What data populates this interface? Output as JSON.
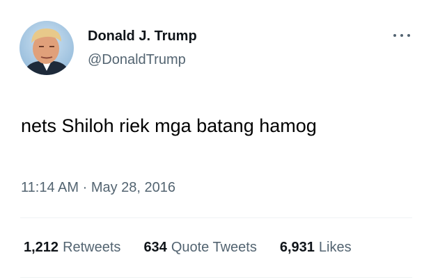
{
  "author": {
    "name": "Donald J. Trump",
    "handle": "@DonaldTrump"
  },
  "menu_icon": "more-horizontal-icon",
  "tweet": {
    "text": "nets Shiloh riek mga batang hamog",
    "time": "11:14 AM",
    "separator": "·",
    "date": "May 28, 2016"
  },
  "stats": [
    {
      "count": "1,212",
      "label": "Retweets"
    },
    {
      "count": "634",
      "label": "Quote Tweets"
    },
    {
      "count": "6,931",
      "label": "Likes"
    }
  ],
  "colors": {
    "secondary_text": "#536471",
    "divider": "#eff3f4"
  }
}
